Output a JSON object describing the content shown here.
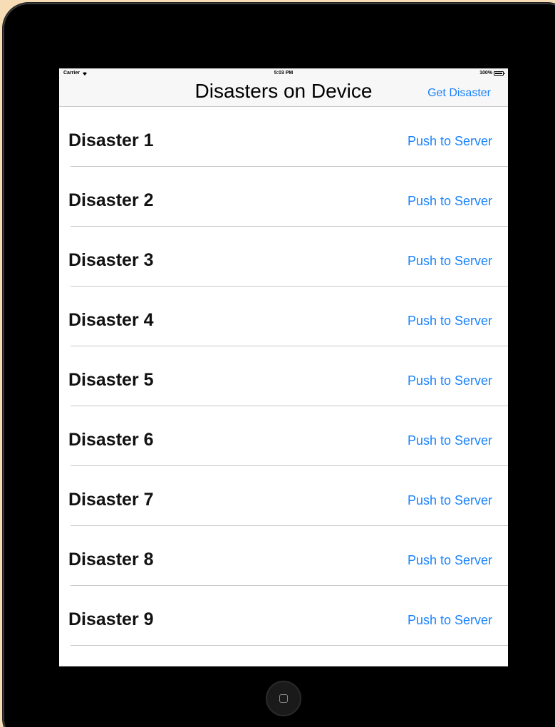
{
  "status_bar": {
    "carrier": "Carrier",
    "time": "5:03 PM",
    "battery": "100%"
  },
  "nav": {
    "title": "Disasters on Device",
    "action_label": "Get Disaster"
  },
  "list": {
    "items": [
      {
        "title": "Disaster 1",
        "action": "Push to Server"
      },
      {
        "title": "Disaster 2",
        "action": "Push to Server"
      },
      {
        "title": "Disaster 3",
        "action": "Push to Server"
      },
      {
        "title": "Disaster 4",
        "action": "Push to Server"
      },
      {
        "title": "Disaster 5",
        "action": "Push to Server"
      },
      {
        "title": "Disaster 6",
        "action": "Push to Server"
      },
      {
        "title": "Disaster 7",
        "action": "Push to Server"
      },
      {
        "title": "Disaster 8",
        "action": "Push to Server"
      },
      {
        "title": "Disaster 9",
        "action": "Push to Server"
      }
    ]
  },
  "colors": {
    "accent": "#1a82fb",
    "background": "#f6ddb5",
    "device": "#000000"
  }
}
